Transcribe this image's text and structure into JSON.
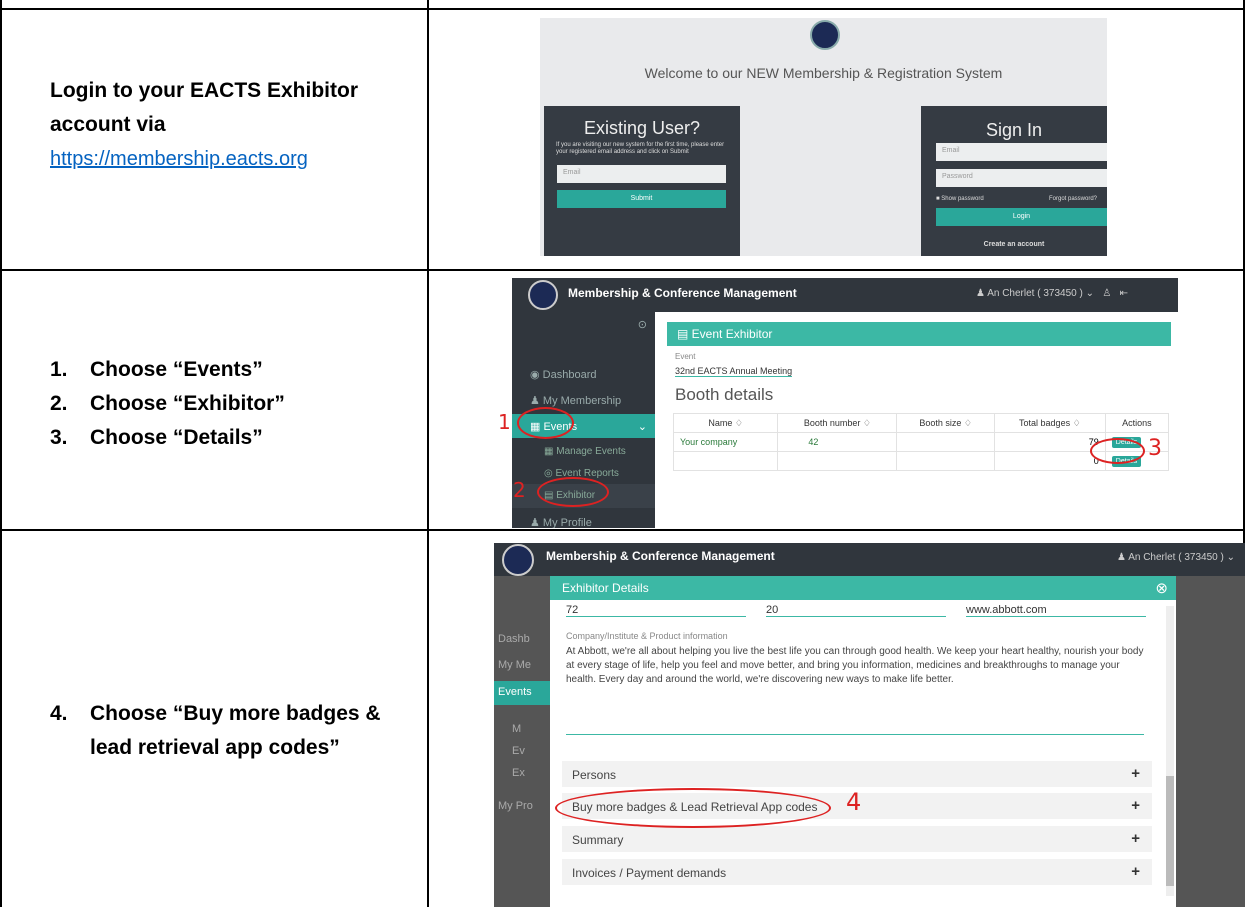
{
  "rows": [
    {
      "instruction": "Login to your EACTS Exhibitor account via",
      "link": "https://membership.eacts.org"
    },
    {
      "steps": [
        {
          "num": "1.",
          "text": "Choose “Events”"
        },
        {
          "num": "2.",
          "text": "Choose “Exhibitor”"
        },
        {
          "num": "3.",
          "text": "Choose “Details”"
        }
      ]
    },
    {
      "steps": [
        {
          "num": "4.",
          "text": "Choose “Buy more badges & lead retrieval app codes”"
        }
      ]
    }
  ],
  "login": {
    "logo_text": "EACTS",
    "welcome": "Welcome to our NEW Membership & Registration System",
    "existing": {
      "title": "Existing User?",
      "info": "If you are visiting our new system for the first time, please enter your registered email address and click on Submit",
      "email_placeholder": "Email",
      "submit": "Submit"
    },
    "signin": {
      "title": "Sign In",
      "email_placeholder": "Email",
      "password_placeholder": "Password",
      "show_password": "Show password",
      "forgot": "Forgot password?",
      "login": "Login",
      "create": "Create an account"
    }
  },
  "app": {
    "brand": "Membership & Conference Management",
    "user": "An Cherlet ( 373450 )"
  },
  "sidebar": {
    "dashboard": "Dashboard",
    "membership": "My Membership",
    "events": "Events",
    "manage": "Manage Events",
    "reports": "Event Reports",
    "exhibitor": "Exhibitor",
    "profile": "My Profile"
  },
  "exhibitor": {
    "header": "Event Exhibitor",
    "event_label": "Event",
    "event_value": "32nd EACTS Annual Meeting",
    "booth_title": "Booth details",
    "columns": [
      "Name ♢",
      "Booth number ♢",
      "Booth size ♢",
      "Total badges ♢",
      "Actions"
    ],
    "rows": [
      {
        "name": "Your company",
        "number": "42",
        "size": "",
        "badges": "79",
        "action": "Details"
      },
      {
        "name": "",
        "number": "",
        "size": "",
        "badges": "0",
        "action": "Details"
      }
    ]
  },
  "details": {
    "header": "Exhibitor Details",
    "row_values": [
      "72",
      "20",
      "www.abbott.com"
    ],
    "info_label": "Company/Institute & Product information",
    "info_text": "At Abbott, we're all about helping you live the best life you can through good health. We keep your heart healthy, nourish your body at every stage of life, help you feel and move better, and bring you information, medicines and breakthroughs to manage your health. Every day and around the world, we're discovering new ways to make life better.",
    "sections": [
      "Persons",
      "Buy more badges & Lead Retrieval App codes",
      "Summary",
      "Invoices / Payment demands"
    ],
    "side_fragments": [
      "Dashb",
      "My Me",
      "Events",
      "M",
      "Ev",
      "Ex",
      "My Pro"
    ]
  },
  "annotations": [
    "1",
    "2",
    "3",
    "4"
  ]
}
